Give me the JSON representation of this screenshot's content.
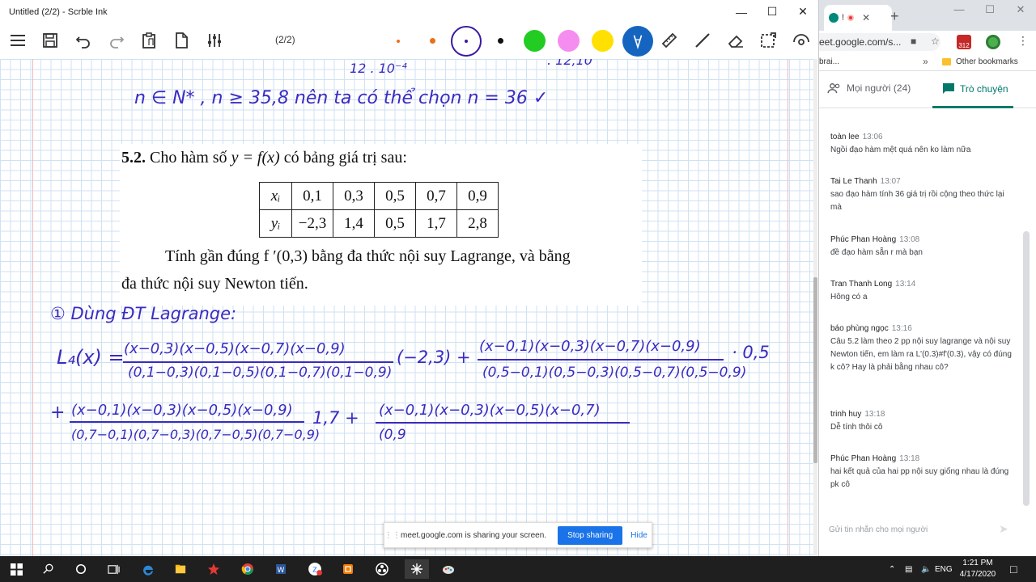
{
  "ink": {
    "title": "Untitled (2/2) - Scrble Ink",
    "page_indicator": "(2/2)",
    "colors": {
      "purple": "#3a2bc0",
      "orange": "#e9711c",
      "red": "#e53935",
      "black": "#111111",
      "green": "#22cc22",
      "pink": "#f58cf0",
      "yellow": "#ffe000",
      "blue": "#1565c0"
    }
  },
  "problem": {
    "number": "5.2.",
    "title_text": "Cho hàm số",
    "func": "y = f(x)",
    "title_tail": "có bảng giá trị sau:",
    "x_label": "xᵢ",
    "y_label": "yᵢ",
    "x_values": [
      "0,1",
      "0,3",
      "0,5",
      "0,7",
      "0,9"
    ],
    "y_values": [
      "−2,3",
      "1,4",
      "0,5",
      "1,7",
      "2,8"
    ],
    "line2": "Tính gần đúng  f ′(0,3)  bằng đa thức nội suy Lagrange, và bằng",
    "line3": "đa thức nội suy Newton tiến."
  },
  "handwriting": {
    "top_partial": "12 . 10⁻⁴",
    "top_right": ". 12,10",
    "n_line": "n ∈ N* ,  n ≥ 35,8  nên ta có thể chọn  n = 36  ✓",
    "heading": "① Dùng ĐT Lagrange:",
    "L_label": "L₄(x) =",
    "t1_num": "(x−0,3)(x−0,5)(x−0,7)(x−0,9)",
    "t1_den": "(0,1−0,3)(0,1−0,5)(0,1−0,7)(0,1−0,9)",
    "t1_coef": "(−2,3) +",
    "t2_num": "(x−0,1)(x−0,3)(x−0,7)(x−0,9)",
    "t2_den": "(0,5−0,1)(0,5−0,3)(0,5−0,7)(0,5−0,9)",
    "t2_coef": "· 0,5",
    "plus": "+",
    "t3_num": "(x−0,1)(x−0,3)(x−0,5)(x−0,9)",
    "t3_den": "(0,7−0,1)(0,7−0,3)(0,7−0,5)(0,7−0,9)",
    "t3_coef": "1,7  +",
    "t4_num": "(x−0,1)(x−0,3)(x−0,5)(x−0,7)",
    "t4_den": "(0,9"
  },
  "share": {
    "message": "meet.google.com is sharing your screen.",
    "stop": "Stop sharing",
    "hide": "Hide"
  },
  "chrome": {
    "tab_label": "!",
    "url": "eet.google.com/s...",
    "badge": "312",
    "bookmark_partial": "brai...",
    "bookmark_more": "»",
    "other_bookmarks": "Other bookmarks"
  },
  "meet": {
    "people_tab": "Mọi người (24)",
    "chat_tab": "Trò chuyện",
    "messages": [
      {
        "sender": "toàn lee",
        "time": "13:06",
        "text": "Ngồi đạo hàm mệt quá nên ko làm nữa"
      },
      {
        "sender": "Tai Le Thanh",
        "time": "13:07",
        "text": "sao đạo hàm tính 36 giá trị rồi cộng theo thức lại mà"
      },
      {
        "sender": "Phúc Phan Hoàng",
        "time": "13:08",
        "text": "đề đạo hàm sẵn r mà bạn"
      },
      {
        "sender": "Tran Thanh Long",
        "time": "13:14",
        "text": "Hông có a"
      },
      {
        "sender": "báo phùng ngọc",
        "time": "13:16",
        "text": "Câu 5.2 làm theo 2 pp nội suy lagrange và nội suy Newton tiến, em làm ra L'(0.3)#f'(0.3), vậy có đúng k cô? Hay là phải bằng nhau cô?"
      },
      {
        "sender": "trinh huy",
        "time": "13:18",
        "text": "Dễ tính thôi cô"
      },
      {
        "sender": "Phúc Phan Hoàng",
        "time": "13:18",
        "text": "hai kết quả của hai pp nội suy giống nhau là đúng pk cô"
      }
    ],
    "input_placeholder": "Gửi tin nhắn cho mọi người"
  },
  "taskbar": {
    "lang": "ENG",
    "time": "1:21 PM",
    "date": "4/17/2020"
  }
}
